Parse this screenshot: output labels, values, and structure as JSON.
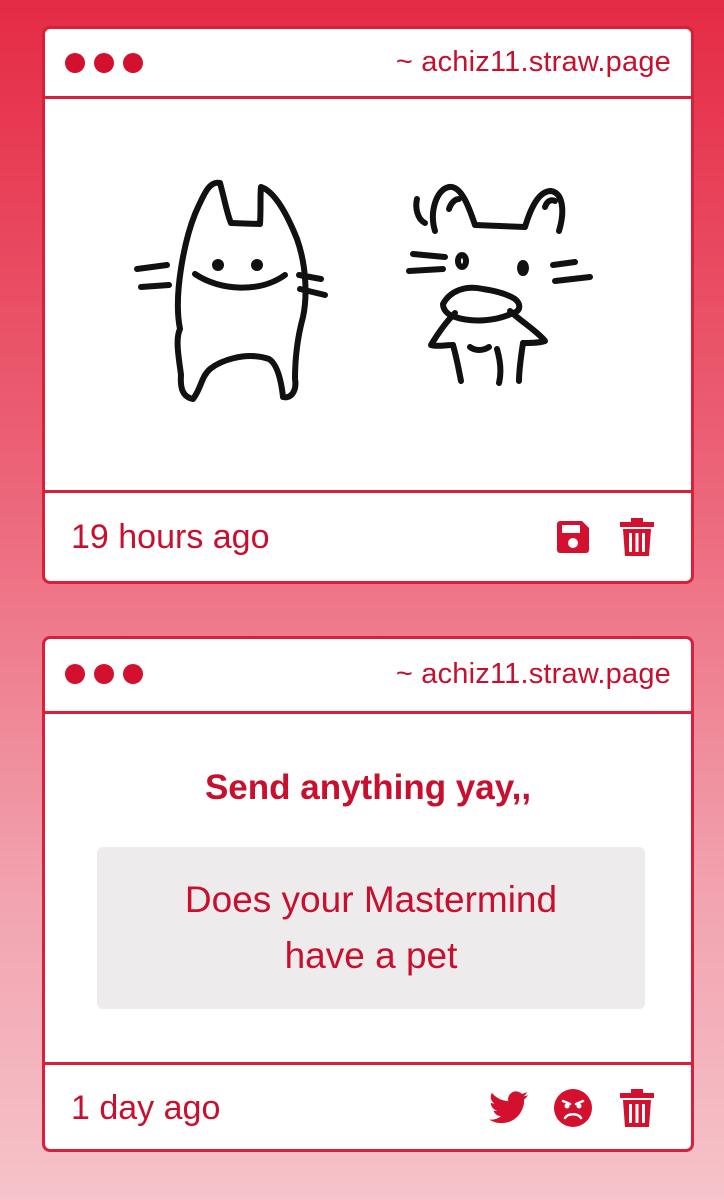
{
  "cards": [
    {
      "url": "~ achiz11.straw.page",
      "time": "19 hours ago",
      "actions": [
        "save-icon",
        "trash-icon"
      ]
    },
    {
      "url": "~ achiz11.straw.page",
      "prompt": "Send anything yay,,",
      "message": "Does your Mastermind have a pet",
      "time": "1 day ago",
      "actions": [
        "twitter-icon",
        "angry-face-icon",
        "trash-icon"
      ]
    }
  ],
  "colors": {
    "accent": "#d3102e",
    "background_top": "#e52b45",
    "background_bottom": "#f6c3ca",
    "message_bg": "#edebec"
  }
}
